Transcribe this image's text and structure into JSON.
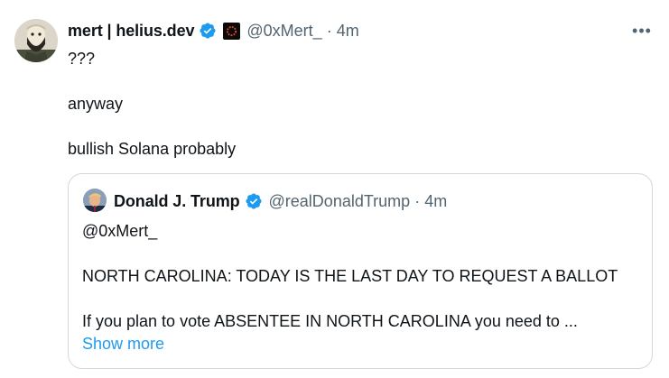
{
  "tweet": {
    "author": {
      "name": "mert | helius.dev",
      "handle": "@0xMert_",
      "verified": true,
      "affiliate_icon": "helius-logo-icon"
    },
    "separator": "·",
    "time": "4m",
    "more_icon": "more-dots-icon",
    "more_label": "•••",
    "lines": [
      "???",
      "anyway",
      "bullish Solana probably"
    ]
  },
  "quoted": {
    "author": {
      "name": "Donald J. Trump",
      "handle": "@realDonaldTrump",
      "verified": true
    },
    "separator": "·",
    "time": "4m",
    "lines": [
      "@0xMert_",
      "NORTH CAROLINA: TODAY IS THE LAST DAY TO REQUEST A BALLOT",
      "If you plan to vote ABSENTEE IN NORTH CAROLINA you need to ..."
    ],
    "show_more": "Show more"
  },
  "colors": {
    "text": "#0f1419",
    "secondary": "#536471",
    "accent": "#1d9bf0",
    "border": "#cfd9de"
  }
}
